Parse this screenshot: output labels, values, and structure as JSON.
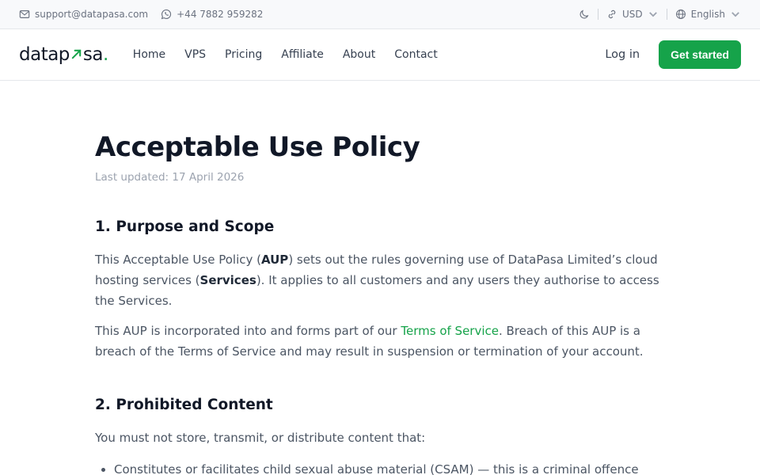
{
  "topbar": {
    "email": "support@datapasa.com",
    "phone": "+44 7882 959282",
    "currency": "USD",
    "language": "English"
  },
  "navbar": {
    "logo_left": "datap",
    "logo_right": "sa",
    "logo_dot": ".",
    "links": [
      "Home",
      "VPS",
      "Pricing",
      "Affiliate",
      "About",
      "Contact"
    ],
    "login": "Log in",
    "cta": "Get started"
  },
  "page": {
    "title": "Acceptable Use Policy",
    "updated": "Last updated: 17 April 2026",
    "section1": {
      "heading": "1. Purpose and Scope",
      "p1": {
        "t1": "This Acceptable Use Policy (",
        "b1": "AUP",
        "t2": ") sets out the rules governing use of DataPasa Limited’s cloud hosting services (",
        "b2": "Services",
        "t3": "). It applies to all customers and any users they authorise to access the Services."
      },
      "p2": {
        "t1": "This AUP is incorporated into and forms part of our ",
        "link": "Terms of Service",
        "t2": ". Breach of this AUP is a breach of the Terms of Service and may result in suspension or termination of your account."
      }
    },
    "section2": {
      "heading": "2. Prohibited Content",
      "intro": "You must not store, transmit, or distribute content that:",
      "items": [
        "Constitutes or facilitates child sexual abuse material (CSAM) — this is a criminal offence"
      ]
    }
  }
}
